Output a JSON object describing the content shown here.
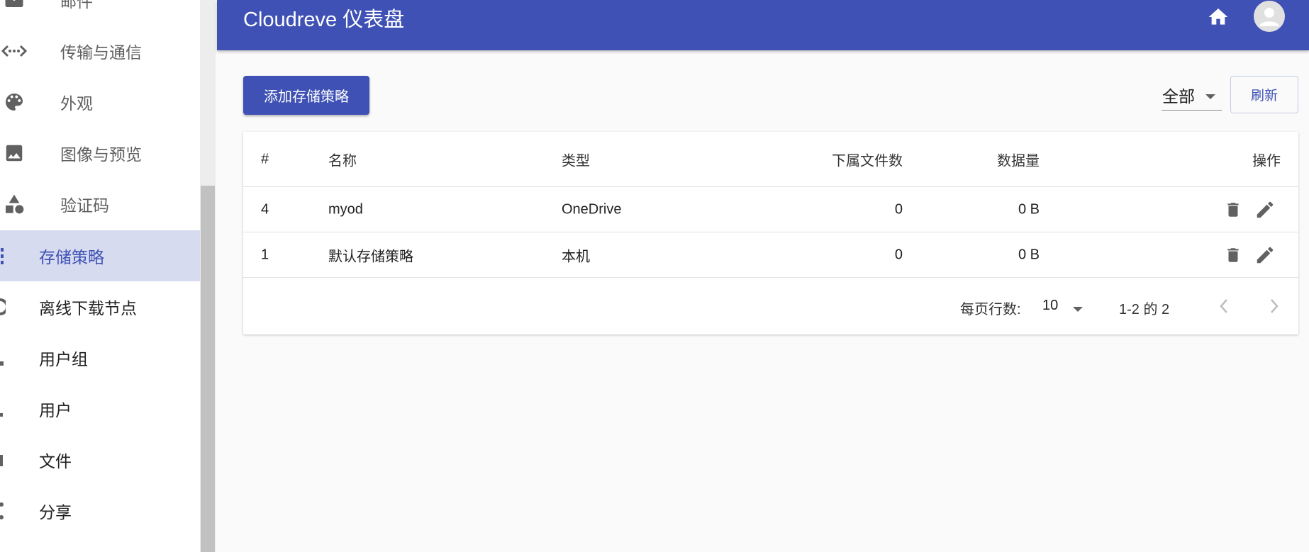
{
  "sidebar": {
    "items": [
      {
        "label": "邮件",
        "icon": "mail-icon",
        "level": "sub"
      },
      {
        "label": "传输与通信",
        "icon": "code-arrows-icon",
        "level": "sub"
      },
      {
        "label": "外观",
        "icon": "palette-icon",
        "level": "sub"
      },
      {
        "label": "图像与预览",
        "icon": "image-icon",
        "level": "sub"
      },
      {
        "label": "验证码",
        "icon": "category-shapes-icon",
        "level": "sub"
      },
      {
        "label": "存储策略",
        "icon": "list-icon",
        "level": "top",
        "active": true
      },
      {
        "label": "离线下载节点",
        "icon": "download-node-icon",
        "level": "top"
      },
      {
        "label": "用户组",
        "icon": "group-icon",
        "level": "top"
      },
      {
        "label": "用户",
        "icon": "person-icon",
        "level": "top"
      },
      {
        "label": "文件",
        "icon": "file-icon",
        "level": "top"
      },
      {
        "label": "分享",
        "icon": "share-icon",
        "level": "top"
      }
    ]
  },
  "appbar": {
    "title": "Cloudreve 仪表盘",
    "color": "#3f51b5"
  },
  "toolbar": {
    "add_label": "添加存储策略",
    "filter_value": "全部",
    "refresh_label": "刷新"
  },
  "table": {
    "headers": {
      "id": "#",
      "name": "名称",
      "type": "类型",
      "files": "下属文件数",
      "size": "数据量",
      "ops": "操作"
    },
    "rows": [
      {
        "id": "4",
        "name": "myod",
        "type": "OneDrive",
        "files": "0",
        "size": "0 B"
      },
      {
        "id": "1",
        "name": "默认存储策略",
        "type": "本机",
        "files": "0",
        "size": "0 B"
      }
    ]
  },
  "pagination": {
    "rows_per_page_label": "每页行数:",
    "rows_per_page": "10",
    "range": "1-2 的 2"
  },
  "colors": {
    "primary": "#3f51b5",
    "active_bg": "#d7dbf0",
    "background": "#fafafa"
  }
}
